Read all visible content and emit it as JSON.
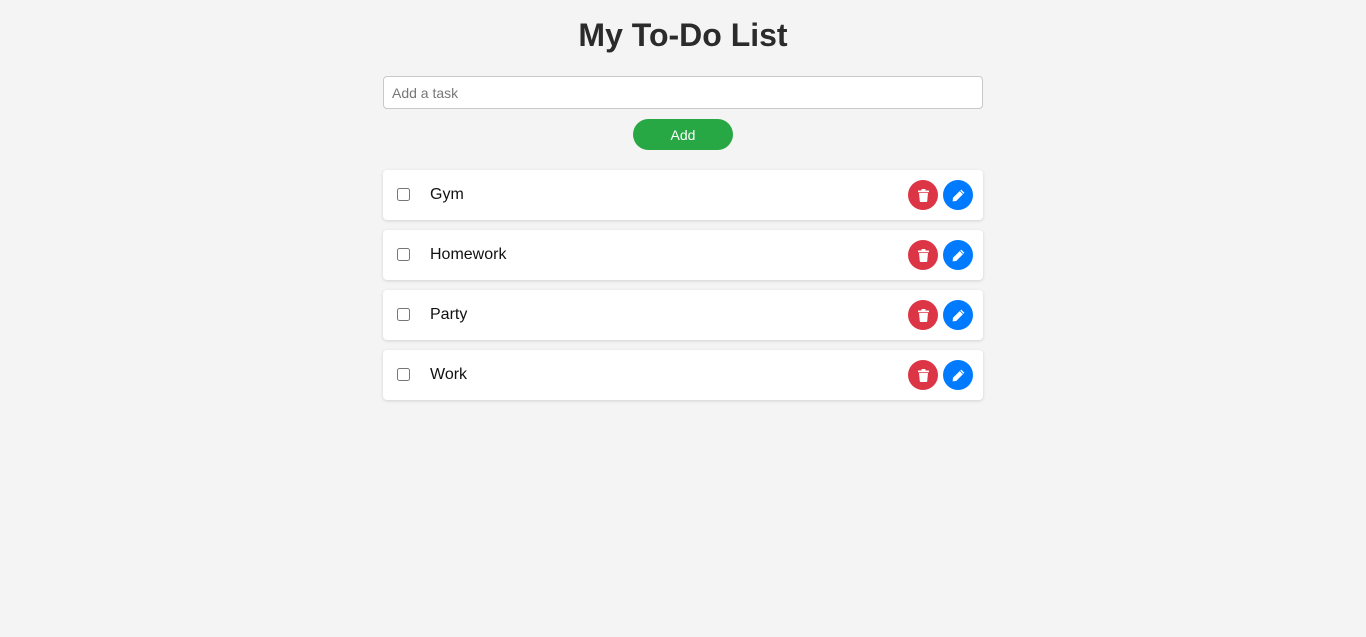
{
  "header": {
    "title": "My To-Do List"
  },
  "input": {
    "placeholder": "Add a task",
    "value": ""
  },
  "add_button": {
    "label": "Add"
  },
  "tasks": [
    {
      "label": "Gym",
      "checked": false
    },
    {
      "label": "Homework",
      "checked": false
    },
    {
      "label": "Party",
      "checked": false
    },
    {
      "label": "Work",
      "checked": false
    }
  ],
  "icons": {
    "delete": "trash-icon",
    "edit": "pencil-icon"
  },
  "colors": {
    "background": "#f4f4f4",
    "add": "#28a745",
    "delete": "#dc3545",
    "edit": "#007bff"
  }
}
